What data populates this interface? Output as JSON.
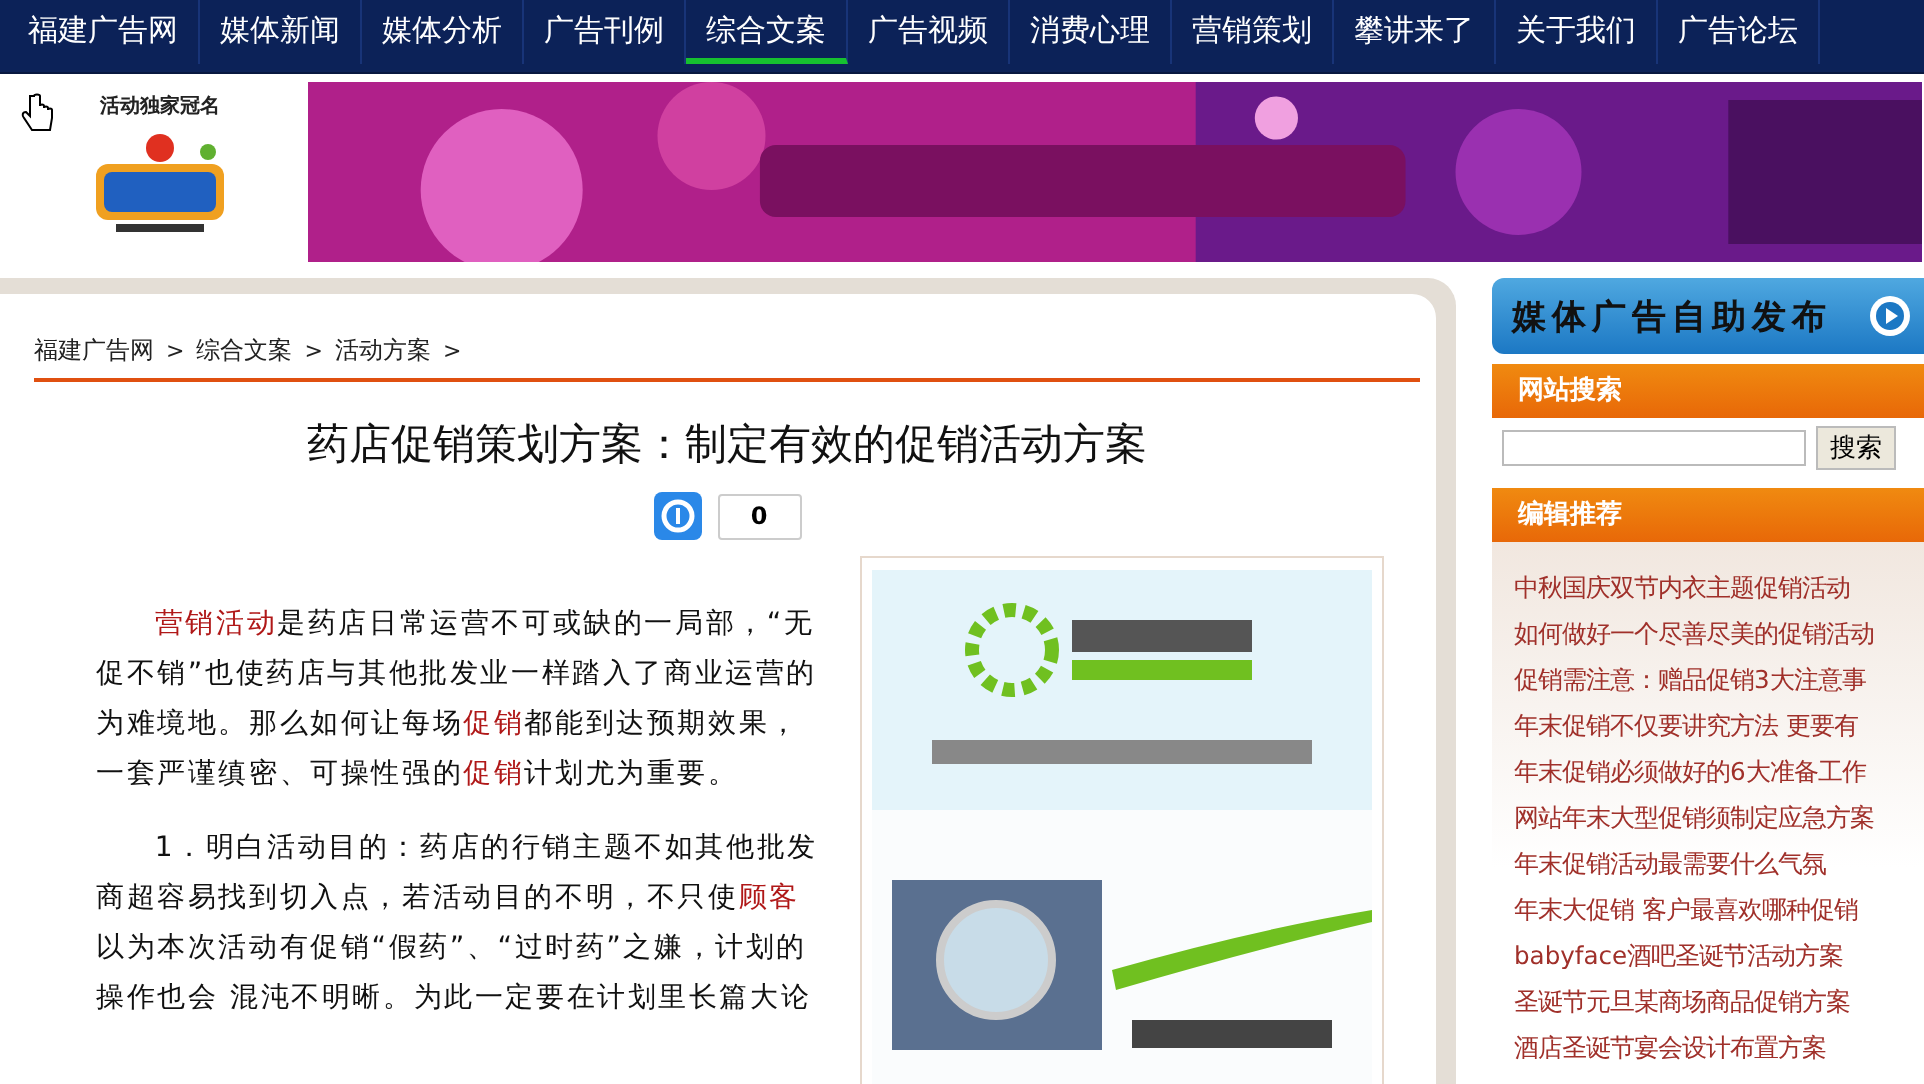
{
  "nav": {
    "items": [
      {
        "label": "福建广告网",
        "selected": false
      },
      {
        "label": "媒体新闻",
        "selected": false
      },
      {
        "label": "媒体分析",
        "selected": false
      },
      {
        "label": "广告刊例",
        "selected": false
      },
      {
        "label": "综合文案",
        "selected": true
      },
      {
        "label": "广告视频",
        "selected": false
      },
      {
        "label": "消费心理",
        "selected": false
      },
      {
        "label": "营销策划",
        "selected": false
      },
      {
        "label": "攀讲来了",
        "selected": false
      },
      {
        "label": "关于我们",
        "selected": false
      },
      {
        "label": "广告论坛",
        "selected": false
      }
    ]
  },
  "header": {
    "sponsor_label": "活动独家冠名"
  },
  "breadcrumb": [
    {
      "label": "福建广告网",
      "separator": ">"
    },
    {
      "label": "综合文案",
      "separator": ">"
    },
    {
      "label": "活动方案",
      "separator": ">"
    }
  ],
  "article": {
    "title": "药店促销策划方案：制定有效的促销活动方案",
    "share_count": "0",
    "paragraphs": [
      [
        {
          "text": "营销活动",
          "link": true
        },
        {
          "text": "是药店日常运营不可或缺的一局部，“无促不销”也使药店与其他批发业一样踏入了商业运营的为难境地。那么如何让每场",
          "link": false
        },
        {
          "text": "促销",
          "link": true
        },
        {
          "text": "都能到达预期效果，一套严谨缜密、可操性强的",
          "link": false
        },
        {
          "text": "促销",
          "link": true
        },
        {
          "text": "计划尤为重要。",
          "link": false
        }
      ],
      [
        {
          "text": "1．明白活动目的：药店的行销主题不如其他批发商超容易找到切入点，若活动目的不明，不只使",
          "link": false
        },
        {
          "text": "顾客",
          "link": true
        },
        {
          "text": "以为本次活动有促销“假药”、“过时药”之嫌，计划的操作也会 混沌不明晰。为此一定要在计划里长篇大论",
          "link": false
        }
      ]
    ]
  },
  "sidebar": {
    "publish_button": "媒体广告自助发布",
    "search": {
      "title": "网站搜索",
      "button": "搜索"
    },
    "recommend": {
      "title": "编辑推荐",
      "items": [
        "中秋国庆双节内衣主题促销活动",
        "如何做好一个尽善尽美的促销活动",
        "促销需注意：赠品促销3大注意事",
        "年末促销不仅要讲究方法 更要有",
        "年末促销必须做好的6大准备工作",
        "网站年末大型促销须制定应急方案",
        "年末促销活动最需要什么气氛",
        "年末大促销 客户最喜欢哪种促销",
        "babyface酒吧圣诞节活动方案",
        "圣诞节元旦某商场商品促销方案",
        "酒店圣诞节宴会设计布置方案"
      ]
    }
  }
}
